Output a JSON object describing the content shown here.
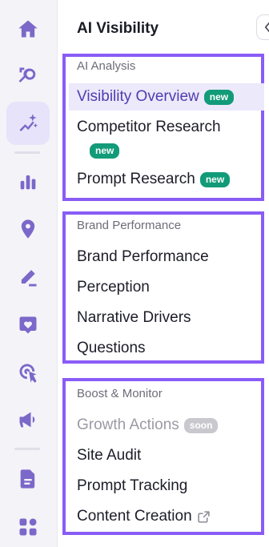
{
  "rail": {
    "icons": [
      "home-icon",
      "search-analysis-icon",
      "sparkles-icon",
      "bar-chart-icon",
      "location-pin-icon",
      "edit-pen-icon",
      "heart-chat-icon",
      "target-click-icon",
      "megaphone-icon",
      "document-icon",
      "apps-grid-icon"
    ],
    "active": "sparkles-icon"
  },
  "panel": {
    "title": "AI Visibility",
    "groups": [
      {
        "label": "AI Analysis",
        "items": [
          {
            "label": "Visibility Overview",
            "badge": "new"
          },
          {
            "label": "Competitor Research",
            "badge": "new"
          },
          {
            "label": "Prompt Research",
            "badge": "new"
          }
        ]
      },
      {
        "label": "Brand Performance",
        "items": [
          {
            "label": "Brand Performance"
          },
          {
            "label": "Perception"
          },
          {
            "label": "Narrative Drivers"
          },
          {
            "label": "Questions"
          }
        ]
      },
      {
        "label": "Boost & Monitor",
        "items": [
          {
            "label": "Growth Actions",
            "badge": "soon"
          },
          {
            "label": "Site Audit"
          },
          {
            "label": "Prompt Tracking"
          },
          {
            "label": "Content Creation",
            "icon": "external-link-icon"
          }
        ]
      }
    ]
  },
  "colors": {
    "accent": "#8a5cf6",
    "rail_icon": "#7b68c9",
    "new_badge": "#129b78",
    "active_bg": "#ece9fb"
  }
}
